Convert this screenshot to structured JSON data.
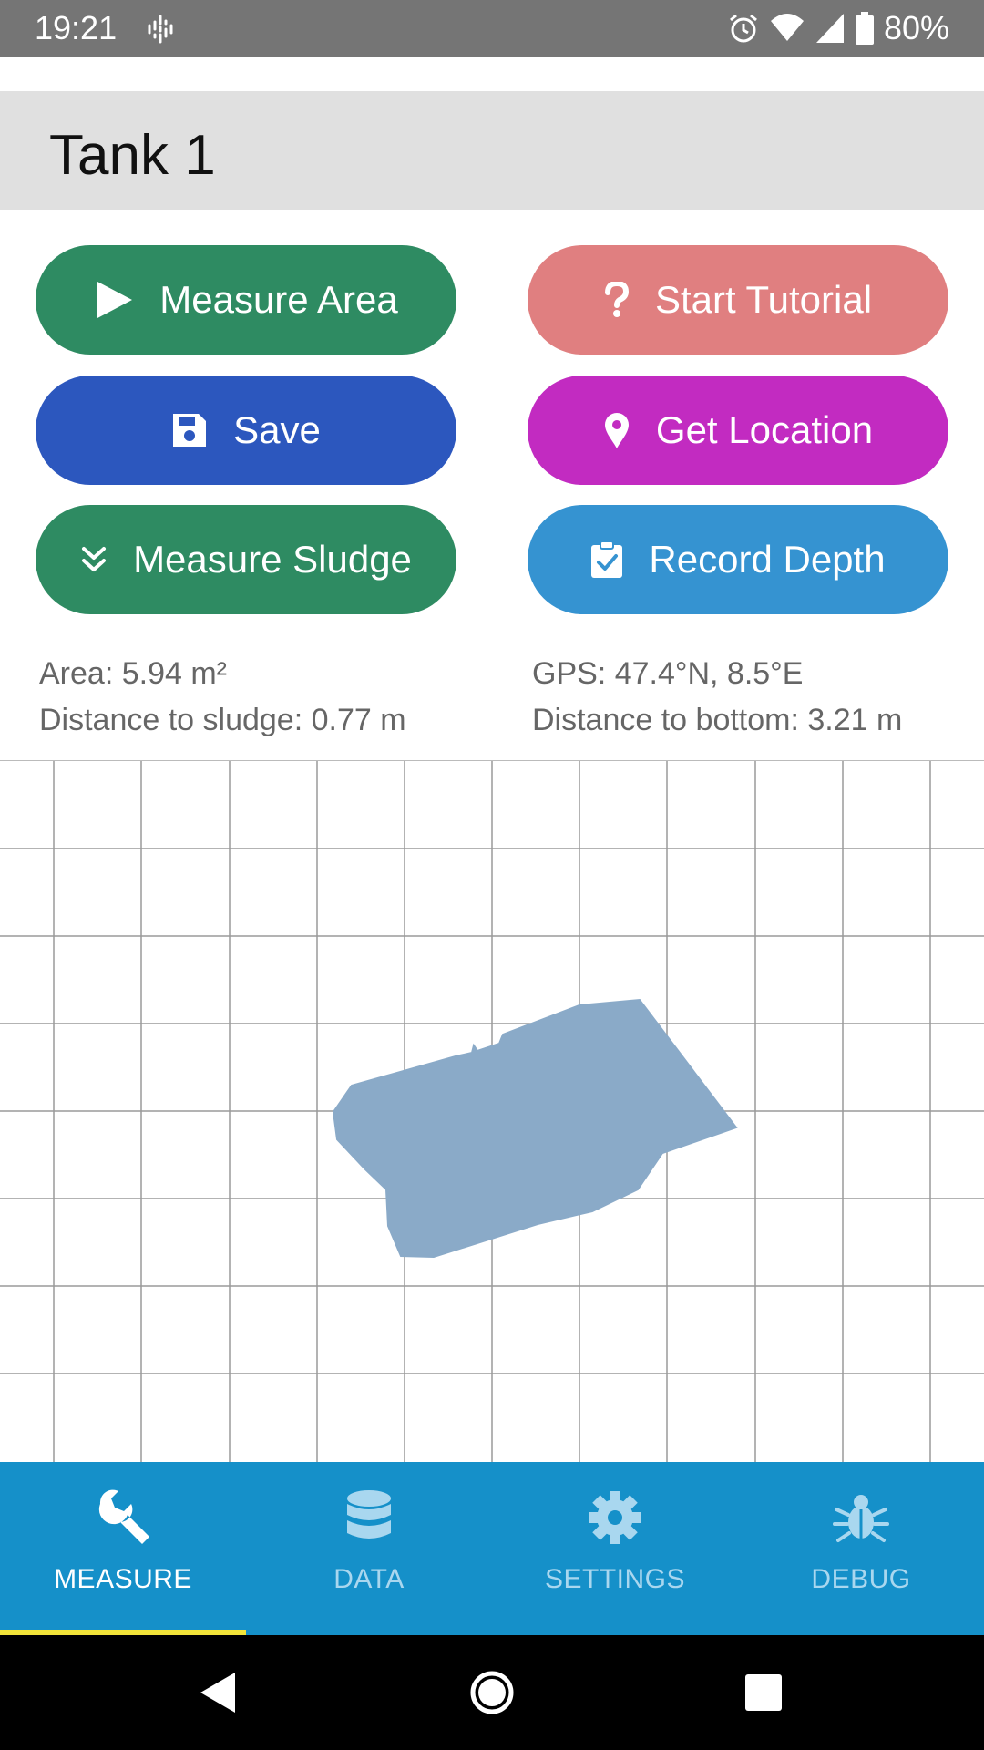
{
  "status_bar": {
    "time": "19:21",
    "battery": "80%",
    "icons": [
      "podcast-icon",
      "alarm-icon",
      "wifi-icon",
      "signal-icon",
      "battery-icon"
    ]
  },
  "title": "Tank 1",
  "buttons": {
    "measure_area": {
      "label": "Measure Area",
      "icon": "play-icon",
      "color": "#2e8b62"
    },
    "start_tutorial": {
      "label": "Start Tutorial",
      "icon": "question-icon",
      "color": "#e07f80"
    },
    "save": {
      "label": "Save",
      "icon": "floppy-disk-icon",
      "color": "#2c57be"
    },
    "get_location": {
      "label": "Get Location",
      "icon": "map-pin-icon",
      "color": "#c22bc1"
    },
    "measure_sludge": {
      "label": "Measure Sludge",
      "icon": "double-chevron-down-icon",
      "color": "#2e8b62"
    },
    "record_depth": {
      "label": "Record Depth",
      "icon": "clipboard-check-icon",
      "color": "#3593d1"
    }
  },
  "info": {
    "area": "Area: 5.94 m²",
    "distance_sludge": "Distance to sludge: 0.77 m",
    "gps": "GPS: 47.4°N, 8.5°E",
    "distance_bottom": "Distance to bottom: 3.21 m"
  },
  "bottom_nav": {
    "items": [
      {
        "label": "MEASURE",
        "icon": "wrench-icon",
        "active": true
      },
      {
        "label": "DATA",
        "icon": "database-icon",
        "active": false
      },
      {
        "label": "SETTINGS",
        "icon": "gear-icon",
        "active": false
      },
      {
        "label": "DEBUG",
        "icon": "bug-icon",
        "active": false
      }
    ]
  },
  "system_nav": {
    "icons": [
      "back-icon",
      "home-icon",
      "recents-icon"
    ]
  },
  "colors": {
    "status_bar": "#757575",
    "title_bar": "#e0e0e0",
    "bottom_nav": "#1590c9",
    "nav_indicator": "#f2e43a",
    "area_shape": "#8aaac8"
  }
}
